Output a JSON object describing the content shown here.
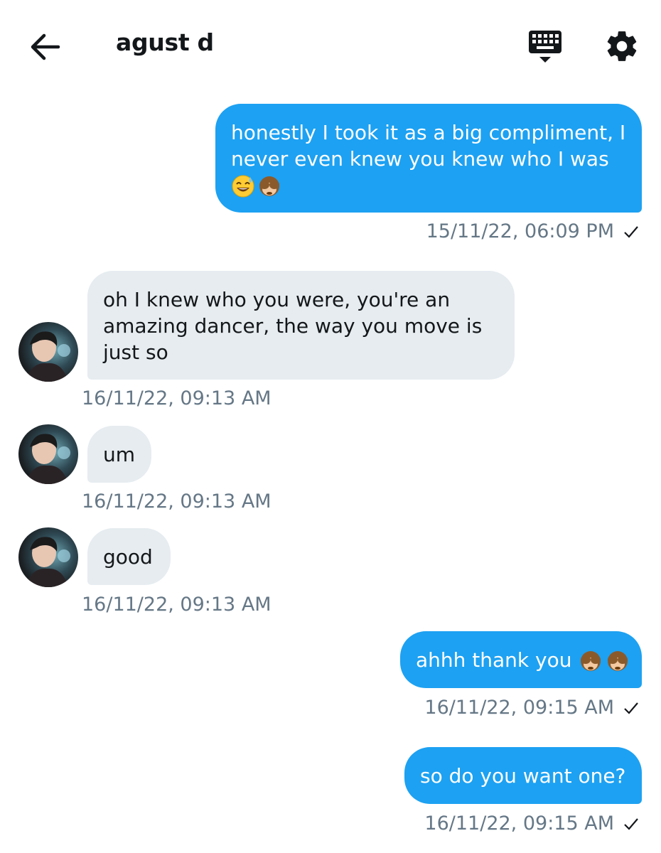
{
  "header": {
    "title": "agust d",
    "back_icon": "arrow-left-icon",
    "keyboard_icon": "keyboard-icon",
    "settings_icon": "gear-icon"
  },
  "colors": {
    "outgoing_bubble": "#1da1f2",
    "incoming_bubble": "#e6ecf0",
    "timestamp": "#657786"
  },
  "messages": [
    {
      "direction": "outgoing",
      "text": "honestly I took it as a big compliment, I never even knew you knew who I was",
      "emoji": [
        "sweat-smile-emoji",
        "see-no-evil-monkey-emoji"
      ],
      "timestamp": "15/11/22, 06:09 PM",
      "status": "sent-check-icon"
    },
    {
      "direction": "incoming",
      "text": "oh I knew who you were, you're an amazing dancer, the way you move is just so",
      "timestamp": "16/11/22, 09:13 AM"
    },
    {
      "direction": "incoming",
      "text": "um",
      "timestamp": "16/11/22, 09:13 AM"
    },
    {
      "direction": "incoming",
      "text": "good",
      "timestamp": "16/11/22, 09:13 AM"
    },
    {
      "direction": "outgoing",
      "text": "ahhh thank you",
      "emoji": [
        "see-no-evil-monkey-emoji",
        "see-no-evil-monkey-emoji"
      ],
      "timestamp": "16/11/22, 09:15 AM",
      "status": "sent-check-icon"
    },
    {
      "direction": "outgoing",
      "text": "so do you want one?",
      "timestamp": "16/11/22, 09:15 AM",
      "status": "sent-check-icon"
    }
  ]
}
